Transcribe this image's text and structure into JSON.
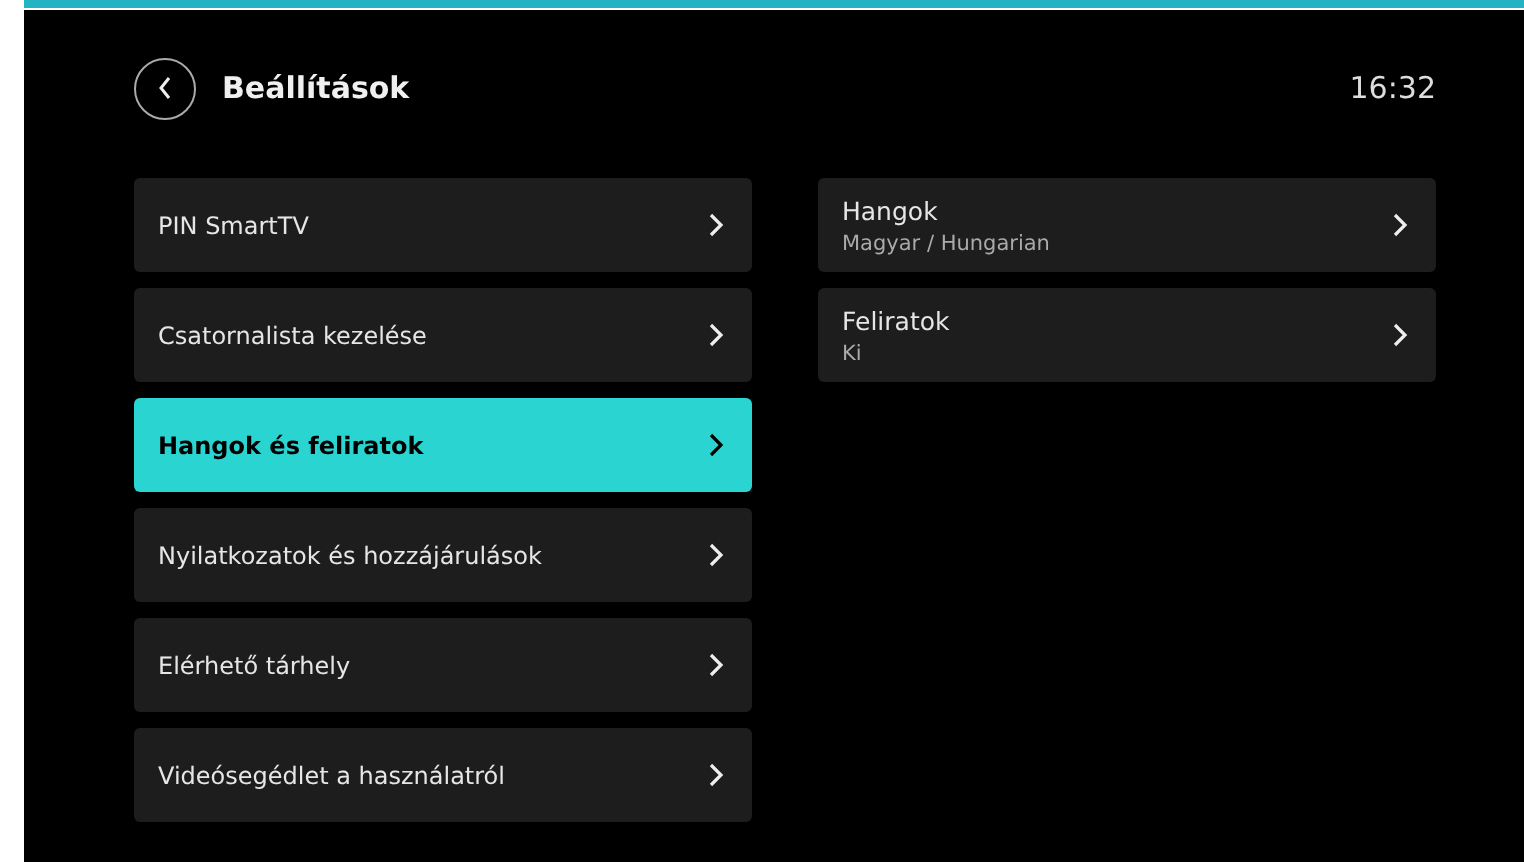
{
  "header": {
    "title": "Beállítások",
    "time": "16:32"
  },
  "menu": [
    {
      "label": "PIN SmartTV",
      "selected": false
    },
    {
      "label": "Csatornalista kezelése",
      "selected": false
    },
    {
      "label": "Hangok és feliratok",
      "selected": true
    },
    {
      "label": "Nyilatkozatok és hozzájárulások",
      "selected": false
    },
    {
      "label": "Elérhető tárhely",
      "selected": false
    },
    {
      "label": "Videósegédlet a használatról",
      "selected": false
    }
  ],
  "details": [
    {
      "title": "Hangok",
      "value": "Magyar / Hungarian"
    },
    {
      "title": "Feliratok",
      "value": "Ki"
    }
  ]
}
